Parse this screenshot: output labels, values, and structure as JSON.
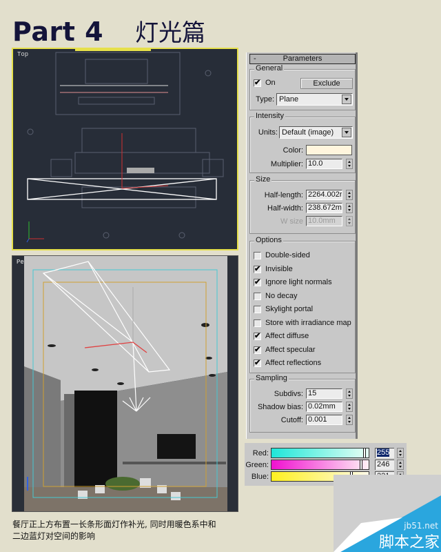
{
  "header": {
    "part": "Part 4",
    "chapter": "灯光篇"
  },
  "viewports": {
    "top_label": "Top",
    "persp_label": "Pe"
  },
  "panel": {
    "rollout_title": "Parameters",
    "rollout_toggle": "-",
    "general": {
      "title": "General",
      "on_label": "On",
      "on_checked": true,
      "exclude_label": "Exclude",
      "type_label": "Type:",
      "type_value": "Plane"
    },
    "intensity": {
      "title": "Intensity",
      "units_label": "Units:",
      "units_value": "Default (image)",
      "color_label": "Color:",
      "color_hex": "#fff5dd",
      "multiplier_label": "Multiplier:",
      "multiplier_value": "10.0"
    },
    "size": {
      "title": "Size",
      "half_length_label": "Half-length:",
      "half_length_value": "2264.002r",
      "half_width_label": "Half-width:",
      "half_width_value": "238.672m",
      "w_size_label": "W size",
      "w_size_value": "10.0mm"
    },
    "options": {
      "title": "Options",
      "items": [
        {
          "label": "Double-sided",
          "checked": false
        },
        {
          "label": "Invisible",
          "checked": true
        },
        {
          "label": "Ignore light normals",
          "checked": true
        },
        {
          "label": "No decay",
          "checked": false
        },
        {
          "label": "Skylight portal",
          "checked": false
        },
        {
          "label": "Store with irradiance map",
          "checked": false
        },
        {
          "label": "Affect diffuse",
          "checked": true
        },
        {
          "label": "Affect specular",
          "checked": true
        },
        {
          "label": "Affect reflections",
          "checked": true
        }
      ]
    },
    "sampling": {
      "title": "Sampling",
      "subdivs_label": "Subdivs:",
      "subdivs_value": "15",
      "shadow_bias_label": "Shadow bias:",
      "shadow_bias_value": "0.02mm",
      "cutoff_label": "Cutoff:",
      "cutoff_value": "0.001"
    }
  },
  "color_picker": {
    "red_label": "Red:",
    "red_value": "255",
    "green_label": "Green:",
    "green_value": "246",
    "blue_label": "Blue:",
    "blue_value": "221",
    "red_colors": [
      "#1ee6d8",
      "#e8fff4"
    ],
    "green_colors": [
      "#f010d0",
      "#fff0f4"
    ],
    "blue_colors": [
      "#fff020",
      "#fffbe8"
    ]
  },
  "caption": {
    "line1": "餐厅正上方布置一长条形面灯作补光, 同时用暖色系中和",
    "line2": "二边蓝灯对空间的影响"
  },
  "watermark": {
    "url": "jb51.net",
    "name": "脚本之家",
    "color": "#2aa6de"
  }
}
